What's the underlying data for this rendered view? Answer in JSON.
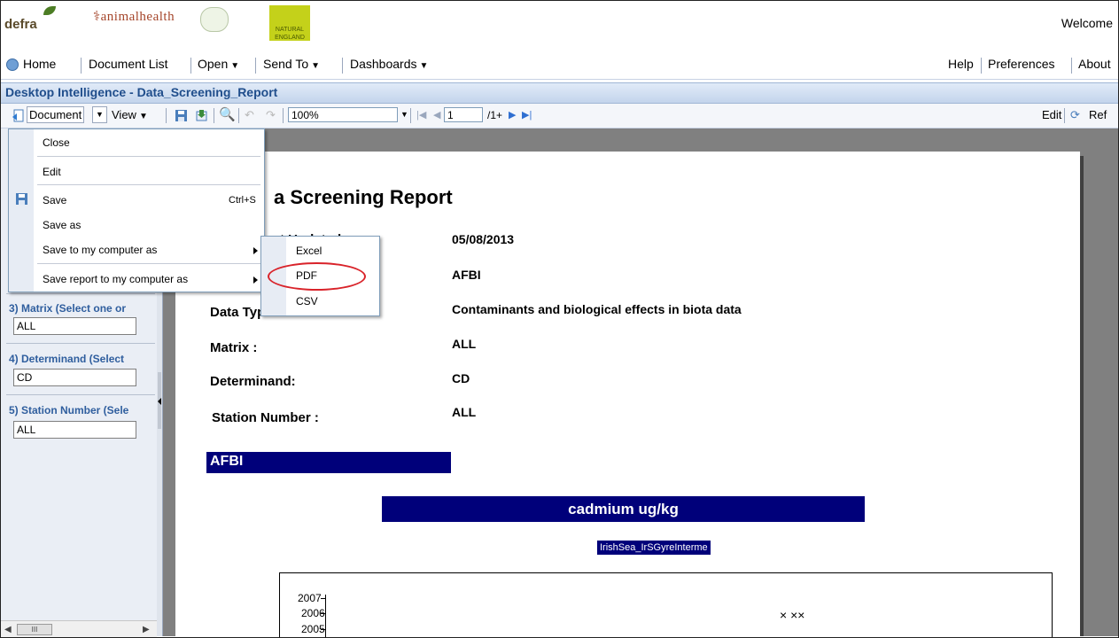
{
  "banner": {
    "logos": [
      "defra",
      "animalhealth",
      "NATURAL ENGLAND"
    ],
    "welcome": "Welcome"
  },
  "topmenu": {
    "home": "Home",
    "document_list": "Document List",
    "open": "Open",
    "send_to": "Send To",
    "dashboards": "Dashboards",
    "help": "Help",
    "preferences": "Preferences",
    "about": "About"
  },
  "titlebar": {
    "title": "Desktop Intelligence - Data_Screening_Report"
  },
  "toolbar": {
    "document": "Document",
    "view": "View",
    "zoom": "100%",
    "page": "1",
    "page_total": "/1+",
    "edit": "Edit",
    "refresh": "Ref"
  },
  "doc_menu": {
    "close": "Close",
    "edit": "Edit",
    "save": "Save",
    "save_shortcut": "Ctrl+S",
    "save_as": "Save as",
    "save_to_computer": "Save to my computer as",
    "save_report_to_computer": "Save report to my computer as"
  },
  "save_submenu": {
    "excel": "Excel",
    "pdf": "PDF",
    "csv": "CSV"
  },
  "prompts": [
    {
      "label": "3) Matrix (Select one or",
      "value": "ALL"
    },
    {
      "label": "4) Determinand (Select",
      "value": "CD"
    },
    {
      "label": "5) Station Number (Sele",
      "value": "ALL"
    }
  ],
  "scroll": {
    "thumb": "III"
  },
  "report": {
    "title_partial": "a Screening Report",
    "partial_label": "t Updated :",
    "date": "05/08/2013",
    "org": "AFBI",
    "data_type_label": "Data Type:",
    "data_type_value": "Contaminants and biological effects in biota data",
    "matrix_label": "Matrix :",
    "matrix_value": "ALL",
    "determinand_label": "Determinand:",
    "determinand_value": "CD",
    "station_label": "Station Number :",
    "station_value": "ALL",
    "section": "AFBI",
    "chart_title": "cadmium  ug/kg",
    "station_tag": "IrishSea_IrSGyreInterme",
    "y_ticks": [
      "2007",
      "2006",
      "2005"
    ],
    "markers": "×  ××"
  },
  "colors": {
    "report_bar": "#00007a",
    "prompt_label": "#2f5e9e",
    "highlight_ellipse": "#d9232a"
  }
}
